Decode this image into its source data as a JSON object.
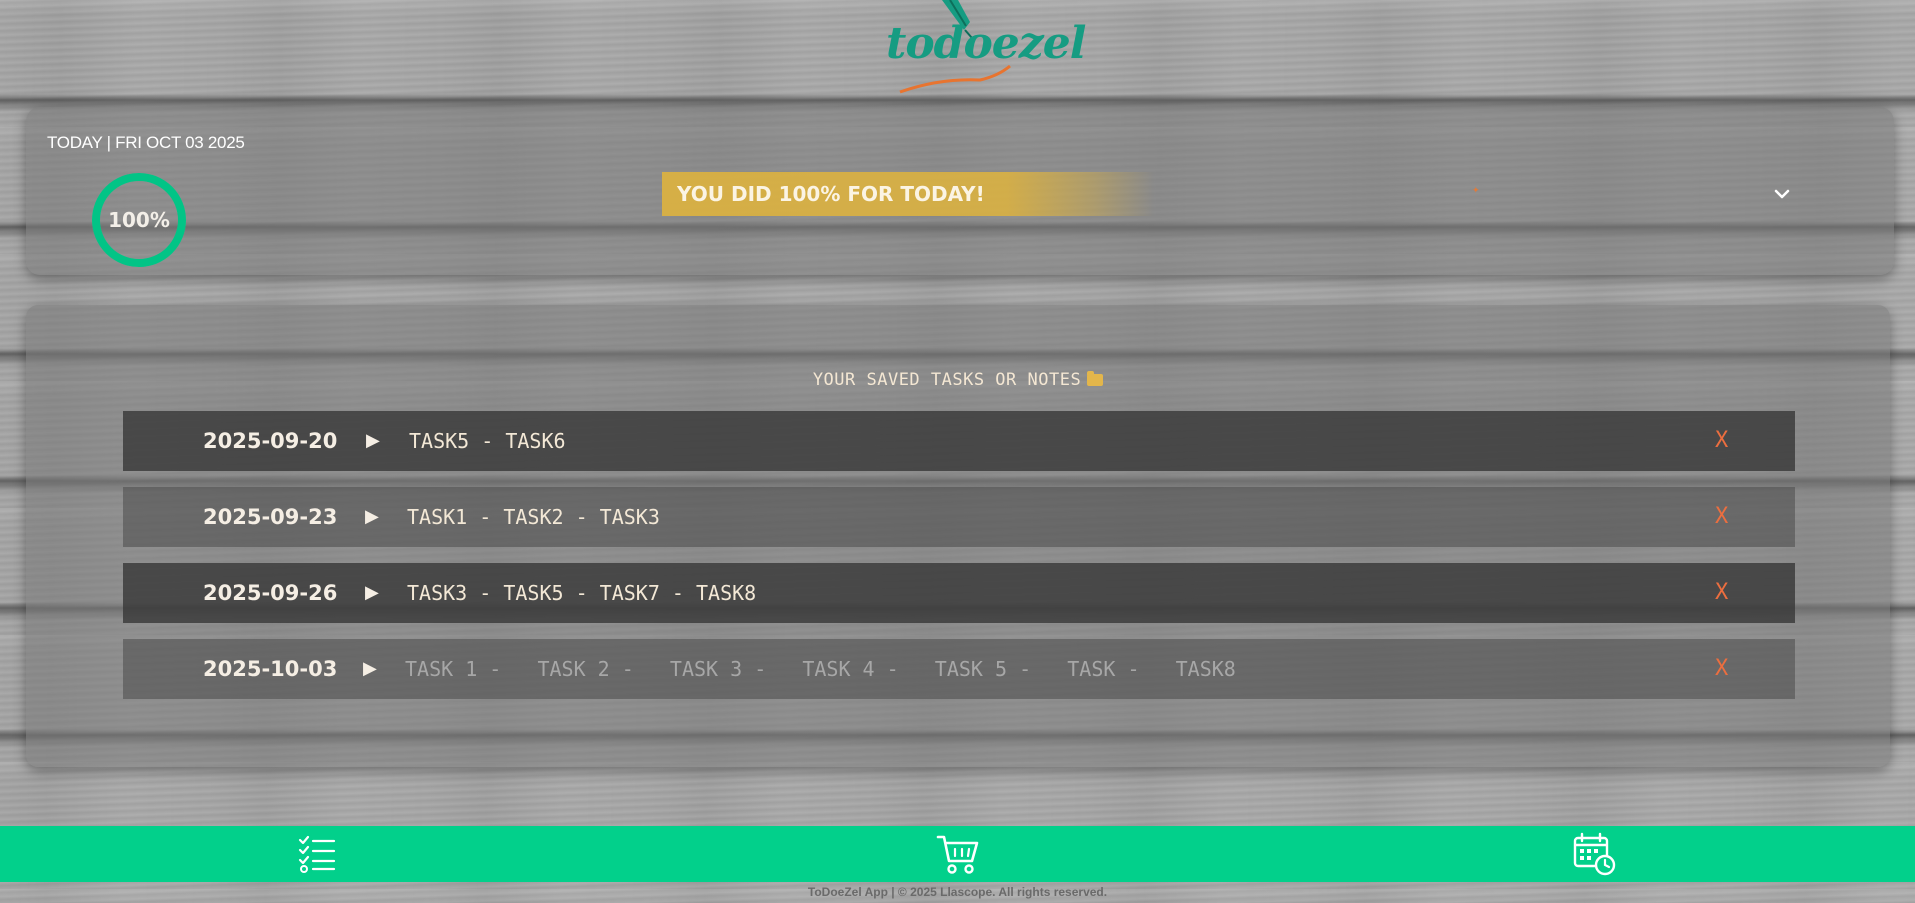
{
  "app": {
    "logo_text": "todoezel"
  },
  "today": {
    "label": "TODAY | FRI OCT 03 2025",
    "progress_percent": 100,
    "progress_label": "100%",
    "banner": "YOU DID 100% FOR TODAY!"
  },
  "saved": {
    "title": "YOUR SAVED TASKS OR NOTES",
    "rows": [
      {
        "date": "2025-09-20",
        "tasks": "TASK5 - TASK6",
        "delete_label": "X"
      },
      {
        "date": "2025-09-23",
        "tasks": "TASK1 - TASK2 - TASK3",
        "delete_label": "X"
      },
      {
        "date": "2025-09-26",
        "tasks": "TASK3 - TASK5 - TASK7 - TASK8",
        "delete_label": "X"
      },
      {
        "date": "2025-10-03",
        "tasks": "TASK 1 -   TASK 2 -   TASK 3 -   TASK 4 -   TASK 5 -   TASK -   TASK8",
        "delete_label": "X"
      }
    ]
  },
  "nav": {
    "items": [
      {
        "icon": "checklist-icon"
      },
      {
        "icon": "cart-icon"
      },
      {
        "icon": "calendar-clock-icon"
      }
    ]
  },
  "footer": {
    "text": "ToDoeZel App | © 2025 Llascope. All rights reserved."
  },
  "colors": {
    "accent_green": "#02d08b",
    "banner_gold": "#dcb240",
    "delete_orange": "#ec6e3f",
    "logo_teal": "#169c82"
  }
}
